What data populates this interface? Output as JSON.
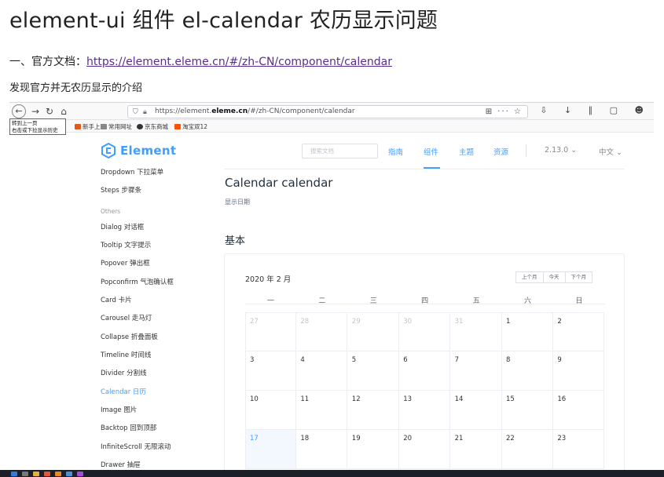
{
  "post": {
    "title": "element-ui 组件 el-calendar 农历显示问题",
    "line1_prefix": "一、官方文档：",
    "line1_link": "https://element.eleme.cn/#/zh-CN/component/calendar",
    "line2": "发现官方并无农历显示的介绍"
  },
  "browser": {
    "url_prefix": "https://element.",
    "url_domain": "eleme.cn",
    "url_suffix": "/#/zh-CN/component/calendar",
    "url_right_icons": "⊞ ··· ☆",
    "toolbar_right": "⇩ ↓ ∥ ▢ ☻",
    "tooltip_line1": "转到上一页",
    "tooltip_line2": "右击或下拉显示历史",
    "bookmarks": [
      {
        "label": "新手上路",
        "color": "#e05a1c"
      },
      {
        "label": "常用网址",
        "color": "#888888"
      },
      {
        "label": "京东商城",
        "color": "#333333"
      },
      {
        "label": "淘宝双12",
        "color": "#ff5000"
      }
    ]
  },
  "site": {
    "logo": "Element",
    "search_placeholder": "搜索文档",
    "nav": [
      "指南",
      "组件",
      "主题",
      "资源"
    ],
    "version": "2.13.0 ⌄",
    "lang": "中文 ⌄",
    "accent": "#409eff"
  },
  "sidebar": {
    "items": [
      {
        "label": "Dropdown 下拉菜单"
      },
      {
        "label": "Steps 步骤条"
      },
      {
        "label": "Others"
      },
      {
        "label": "Dialog 对话框"
      },
      {
        "label": "Tooltip 文字提示"
      },
      {
        "label": "Popover 弹出框"
      },
      {
        "label": "Popconfirm 气泡确认框"
      },
      {
        "label": "Card 卡片"
      },
      {
        "label": "Carousel 走马灯"
      },
      {
        "label": "Collapse 折叠面板"
      },
      {
        "label": "Timeline 时间线"
      },
      {
        "label": "Divider 分割线"
      },
      {
        "label": "Calendar 日历"
      },
      {
        "label": "Image 图片"
      },
      {
        "label": "Backtop 回到顶部"
      },
      {
        "label": "InfiniteScroll 无限滚动"
      },
      {
        "label": "Drawer 抽屉"
      }
    ]
  },
  "doc": {
    "title": "Calendar calendar",
    "subtitle": "显示日期",
    "section": "基本"
  },
  "calendar": {
    "title": "2020 年 2 月",
    "buttons": [
      "上个月",
      "今天",
      "下个月"
    ],
    "weekdays": [
      "一",
      "二",
      "三",
      "四",
      "五",
      "六",
      "日"
    ],
    "rows": [
      [
        {
          "d": "27",
          "prev": true
        },
        {
          "d": "28",
          "prev": true
        },
        {
          "d": "29",
          "prev": true
        },
        {
          "d": "30",
          "prev": true
        },
        {
          "d": "31",
          "prev": true
        },
        {
          "d": "1"
        },
        {
          "d": "2"
        }
      ],
      [
        {
          "d": "3"
        },
        {
          "d": "4"
        },
        {
          "d": "5"
        },
        {
          "d": "6"
        },
        {
          "d": "7"
        },
        {
          "d": "8"
        },
        {
          "d": "9"
        }
      ],
      [
        {
          "d": "10"
        },
        {
          "d": "11"
        },
        {
          "d": "12"
        },
        {
          "d": "13"
        },
        {
          "d": "14"
        },
        {
          "d": "15"
        },
        {
          "d": "16"
        }
      ],
      [
        {
          "d": "17",
          "sel": true
        },
        {
          "d": "18"
        },
        {
          "d": "19"
        },
        {
          "d": "20"
        },
        {
          "d": "21"
        },
        {
          "d": "22"
        },
        {
          "d": "23"
        }
      ]
    ]
  }
}
